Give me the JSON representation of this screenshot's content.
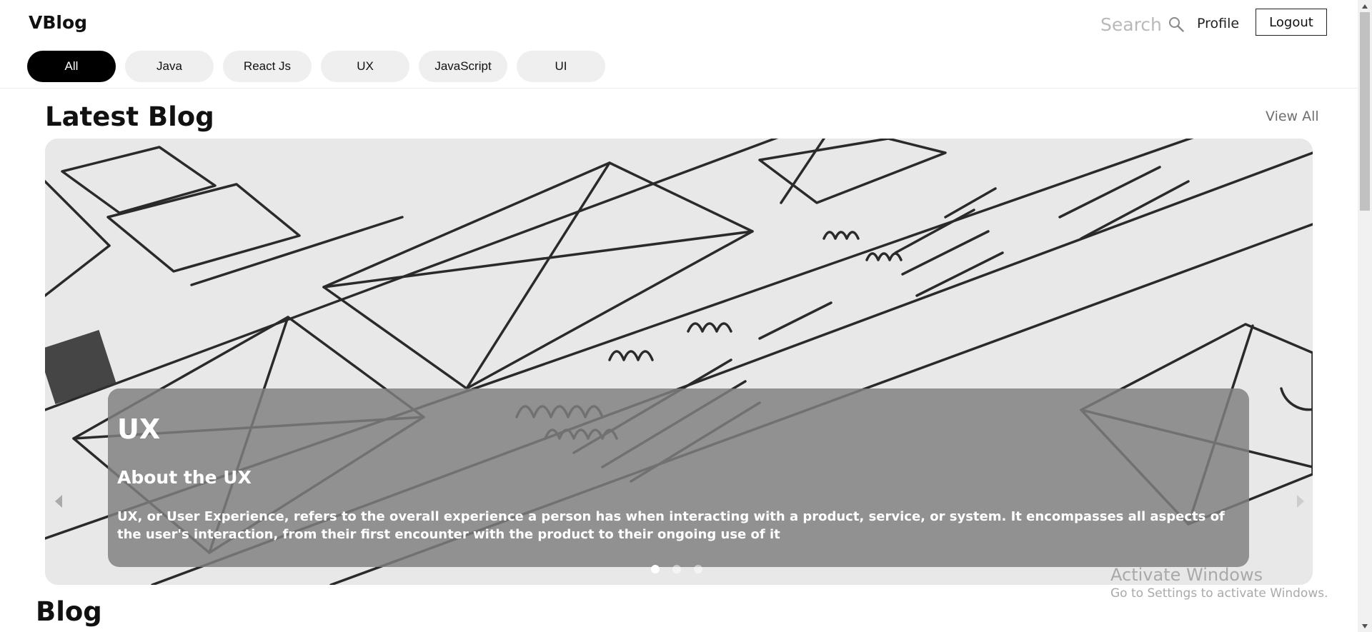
{
  "header": {
    "brand": "VBlog",
    "search_label": "Search",
    "search_icon": "search-icon",
    "profile_label": "Profile",
    "logout_label": "Logout"
  },
  "categories": [
    {
      "label": "All",
      "active": true
    },
    {
      "label": "Java",
      "active": false
    },
    {
      "label": "React Js",
      "active": false
    },
    {
      "label": "UX",
      "active": false
    },
    {
      "label": "JavaScript",
      "active": false
    },
    {
      "label": "UI",
      "active": false
    }
  ],
  "latest": {
    "title": "Latest Blog",
    "view_all": "View All",
    "slide": {
      "category": "UX",
      "title": "About the UX",
      "text": "UX, or User Experience, refers to the overall experience a person has when interacting with a product, service, or system. It encompasses all aspects of the user's interaction, from their first encounter with the product to their ongoing use of it"
    },
    "slide_count": 3,
    "active_slide": 1
  },
  "watermark": {
    "title": "Activate Windows",
    "subtitle": "Go to Settings to activate Windows."
  },
  "blog_section_title": "Blog",
  "colors": {
    "accent": "#000000",
    "chip_background": "#efefef",
    "caption_overlay": "#808080"
  }
}
